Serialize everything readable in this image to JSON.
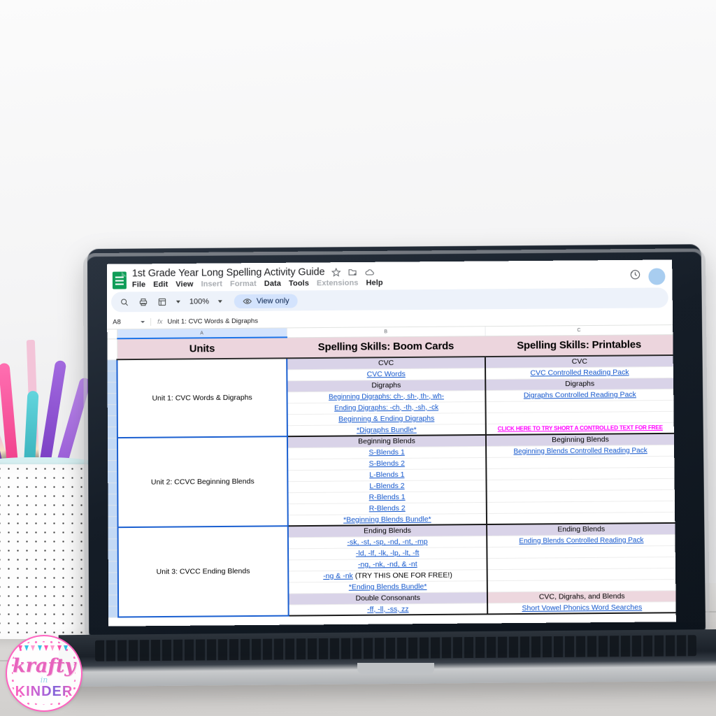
{
  "app": {
    "doc_title": "1st Grade Year Long Spelling Activity Guide",
    "logo_icon": "google-sheets-icon",
    "title_icons": [
      "star-icon",
      "move-to-folder-icon",
      "cloud-saved-icon"
    ],
    "history_icon": "version-history-icon",
    "menu": [
      "File",
      "Edit",
      "View",
      "Insert",
      "Format",
      "Data",
      "Tools",
      "Extensions",
      "Help"
    ],
    "menu_disabled": [
      "Insert",
      "Format",
      "Extensions"
    ]
  },
  "toolbar": {
    "search_icon": "search-icon",
    "print_icon": "print-icon",
    "sheet_icon": "sheet-view-icon",
    "zoom_level": "100%",
    "view_only_label": "View only",
    "view_only_icon": "eye-icon"
  },
  "formula_bar": {
    "name_box": "A8",
    "fx_label": "fx",
    "content": "Unit 1: CVC Words & Digraphs"
  },
  "grid": {
    "column_letters": [
      "A",
      "B",
      "C"
    ],
    "headers": [
      "Units",
      "Spelling Skills: Boom Cards",
      "Spelling Skills: Printables"
    ],
    "units": [
      {
        "name": "Unit 1: CVC Words & Digraphs",
        "boom": [
          {
            "text": "CVC",
            "type": "section"
          },
          {
            "text": "CVC Words",
            "type": "link"
          },
          {
            "text": "Digraphs",
            "type": "section"
          },
          {
            "text": "Beginning Digraphs: ch-, sh-, th-, wh-",
            "type": "link"
          },
          {
            "text": "Ending Digraphs: -ch, -th, -sh, -ck",
            "type": "link"
          },
          {
            "text": "Beginning & Ending Digraphs",
            "type": "link"
          },
          {
            "text": "*Digraphs Bundle*",
            "type": "link"
          }
        ],
        "printables": [
          {
            "text": "CVC",
            "type": "section"
          },
          {
            "text": "CVC Controlled Reading Pack",
            "type": "link"
          },
          {
            "text": "Digraphs",
            "type": "section"
          },
          {
            "text": "Digraphs Controlled Reading Pack",
            "type": "link"
          },
          {
            "text": "",
            "type": "empty"
          },
          {
            "text": "",
            "type": "empty"
          },
          {
            "text": "CLICK HERE TO TRY SHORT A CONTROLLED TEXT FOR FREE",
            "type": "pinklink"
          }
        ]
      },
      {
        "name": "Unit 2: CCVC Beginning Blends",
        "boom": [
          {
            "text": "Beginning Blends",
            "type": "section"
          },
          {
            "text": "S-Blends 1",
            "type": "link"
          },
          {
            "text": "S-Blends 2",
            "type": "link"
          },
          {
            "text": "L-Blends 1",
            "type": "link"
          },
          {
            "text": "L-Blends 2",
            "type": "link"
          },
          {
            "text": "R-Blends 1",
            "type": "link"
          },
          {
            "text": "R-Blends 2",
            "type": "link"
          },
          {
            "text": "*Beginning Blends Bundle*",
            "type": "link"
          }
        ],
        "printables": [
          {
            "text": "Beginning Blends",
            "type": "section"
          },
          {
            "text": "Beginning Blends Controlled Reading Pack",
            "type": "link"
          },
          {
            "text": "",
            "type": "empty"
          },
          {
            "text": "",
            "type": "empty"
          },
          {
            "text": "",
            "type": "empty"
          },
          {
            "text": "",
            "type": "empty"
          },
          {
            "text": "",
            "type": "empty"
          },
          {
            "text": "",
            "type": "empty"
          }
        ]
      },
      {
        "name": "Unit 3: CVCC Ending Blends",
        "boom": [
          {
            "text": "Ending Blends",
            "type": "section"
          },
          {
            "text": "-sk, -st, -sp, -nd, -nt, -mp",
            "type": "link"
          },
          {
            "text": "-ld, -lf, -lk, -lp, -lt, -ft",
            "type": "link"
          },
          {
            "text": "-ng, -nk, -nd, & -nt",
            "type": "link"
          },
          {
            "text": "-ng & -nk",
            "suffix": " (TRY THIS ONE FOR FREE!)",
            "type": "link-suffix"
          },
          {
            "text": "*Ending Blends Bundle*",
            "type": "link"
          },
          {
            "text": "Double Consonants",
            "type": "section"
          },
          {
            "text": "-ff, -ll, -ss, zz",
            "type": "link"
          }
        ],
        "printables": [
          {
            "text": "Ending Blends",
            "type": "section"
          },
          {
            "text": "Ending Blends Controlled Reading Pack",
            "type": "link"
          },
          {
            "text": "",
            "type": "empty"
          },
          {
            "text": "",
            "type": "empty"
          },
          {
            "text": "",
            "type": "empty"
          },
          {
            "text": "",
            "type": "empty"
          },
          {
            "text": "CVC, Digrahs, and Blends",
            "type": "section-pink"
          },
          {
            "text": "Short Vowel Phonics Word Searches",
            "type": "link"
          }
        ]
      }
    ]
  },
  "watermark": {
    "line1": "krafty",
    "line2": "in",
    "line3": "KINDER"
  },
  "colors": {
    "header_pink": "#ecd5dd",
    "section_lavender": "#d9d3e8",
    "section_pink": "#edd7de",
    "link_blue": "#1155cc",
    "free_link_pink": "#ff00ff",
    "selection_blue": "#1a5fd0",
    "sheets_green": "#0f9d58",
    "view_only_bg": "#d3e3fd"
  }
}
